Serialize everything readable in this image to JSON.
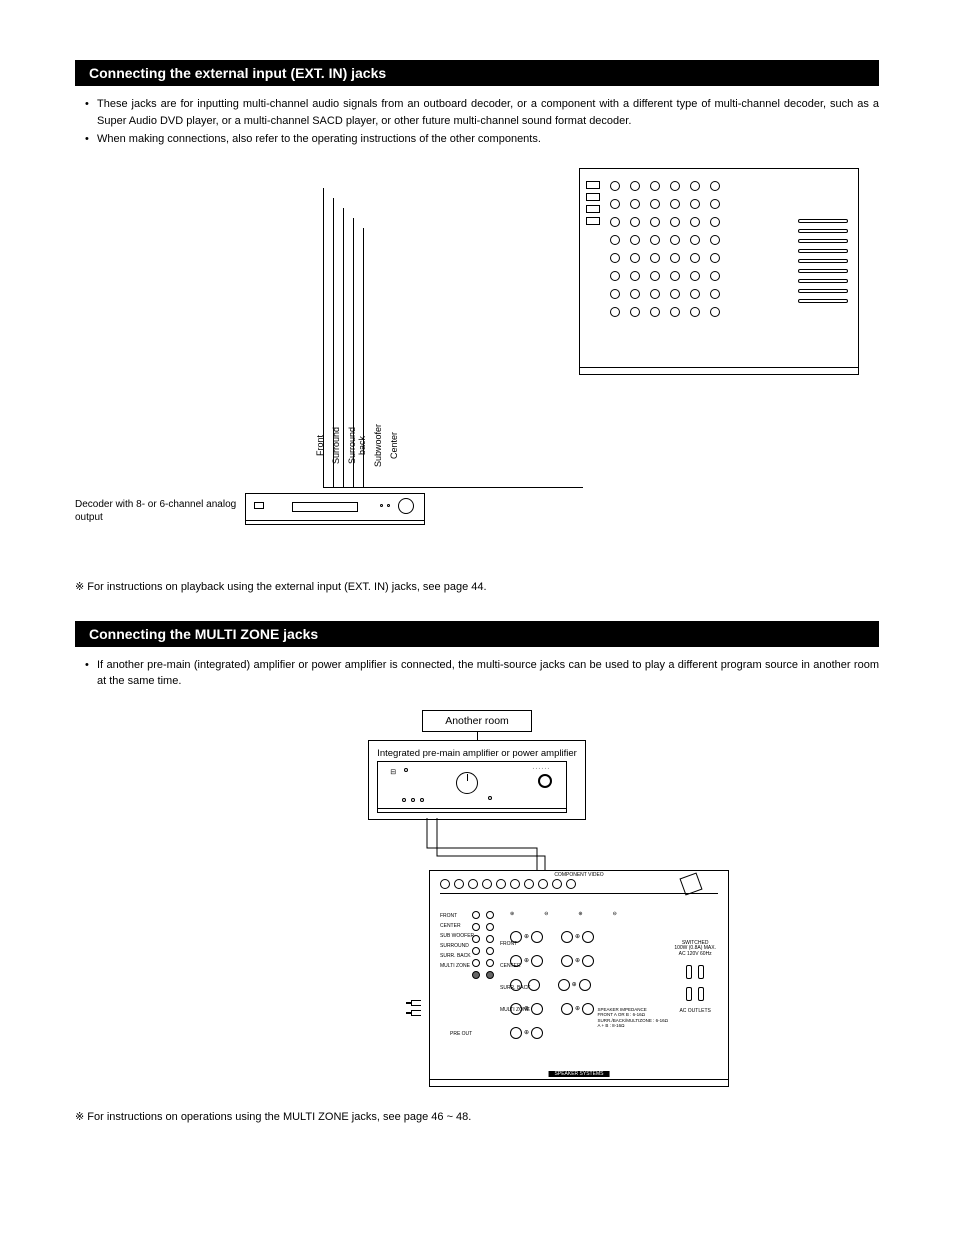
{
  "sections": {
    "ext_in": {
      "header": "Connecting the external input (EXT. IN) jacks",
      "bullets": [
        "These jacks are for inputting multi-channel audio signals from an outboard decoder, or a component with a different type of multi-channel decoder, such as a Super Audio DVD player, or a multi-channel SACD player, or other future multi-channel sound format decoder.",
        "When making connections, also refer to the operating instructions of the other components."
      ],
      "diagram": {
        "decoder_caption": "Decoder with 8- or 6-channel analog output",
        "channel_labels": [
          "Front",
          "Surround",
          "Surround back",
          "Subwoofer",
          "Center"
        ]
      },
      "note": "For instructions on playback using the external input (EXT. IN) jacks, see page 44.",
      "note_symbol": "※"
    },
    "multi_zone": {
      "header": "Connecting the MULTI ZONE jacks",
      "bullets": [
        "If another pre-main (integrated) amplifier or power amplifier is connected, the multi-source jacks can be used to play a different program source in another room at the same time."
      ],
      "diagram": {
        "room_label": "Another room",
        "amp_caption": "Integrated pre-main amplifier or power amplifier",
        "panel_labels": {
          "top_section": "COMPONENT VIDEO",
          "preout_rows": [
            "FRONT",
            "CENTER",
            "SUB WOOFER",
            "SURROUND",
            "SURR. BACK",
            "MULTI ZONE"
          ],
          "preout_label": "PRE OUT",
          "speaker_cols": [
            "FRONT",
            "CENTER",
            "SURR. BACK",
            "MULTI ZONE"
          ],
          "speaker_section": "SPEAKER SYSTEMS",
          "impedance_text": "SPEAKER IMPEDANCE\nFRONT A OR B : 6-16Ω\nSURR./BACK/MULTIZONE : 6-16Ω\nA + B : 8-16Ω",
          "ac_text": "SWITCHED\n100W (0.8A) MAX.\nAC 120V 60Hz",
          "ac_outlets": "AC OUTLETS"
        }
      },
      "note": "For instructions on operations using the MULTI ZONE jacks, see page 46 ~ 48.",
      "note_symbol": "※"
    }
  }
}
